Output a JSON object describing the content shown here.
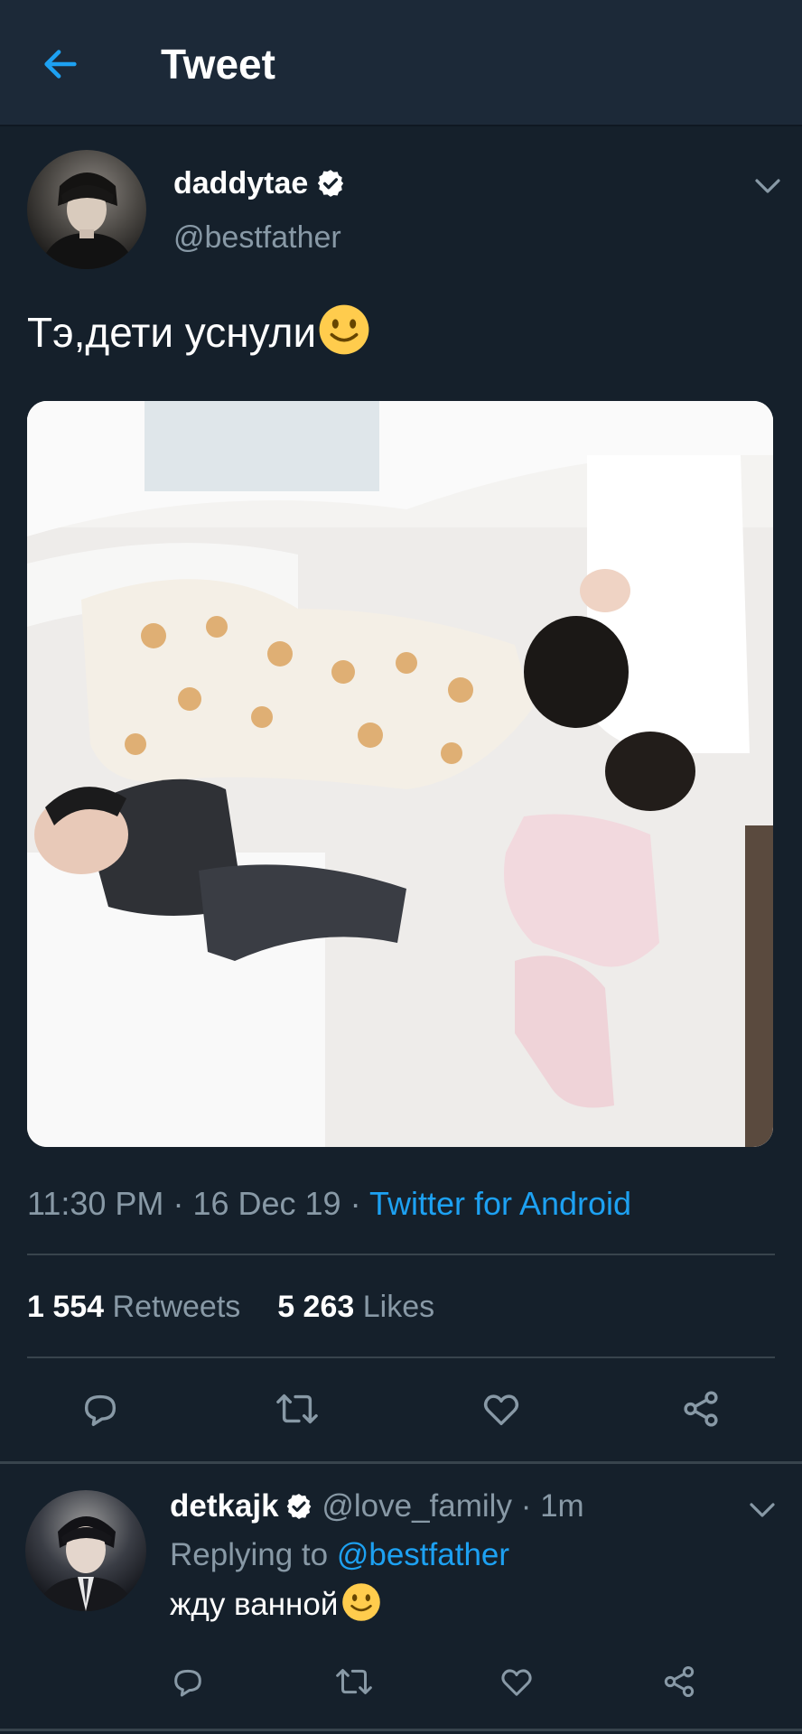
{
  "header": {
    "title": "Tweet",
    "back_icon": "arrow-left-icon"
  },
  "tweet": {
    "author": {
      "name": "daddytae",
      "handle": "@bestfather",
      "verified": true
    },
    "text": "Тэ,дети уснули",
    "time": "11:30 PM",
    "date": "16 Dec 19",
    "source": "Twitter for Android",
    "retweets": {
      "count": "1 554",
      "label": "Retweets"
    },
    "likes": {
      "count": "5 263",
      "label": "Likes"
    },
    "actions": [
      "reply-icon",
      "retweet-icon",
      "like-icon",
      "share-icon"
    ]
  },
  "reply": {
    "author": {
      "name": "detkajk",
      "handle": "@love_family",
      "verified": true
    },
    "time": "1m",
    "replying_to_label": "Replying to",
    "replying_to": "@bestfather",
    "text": "жду ванной",
    "actions": [
      "reply-icon",
      "retweet-icon",
      "like-icon",
      "share-icon"
    ]
  },
  "colors": {
    "background": "#15202b",
    "header": "#1c2938",
    "secondary_text": "#8899a6",
    "accent": "#1da1f2",
    "divider": "#38444d"
  }
}
